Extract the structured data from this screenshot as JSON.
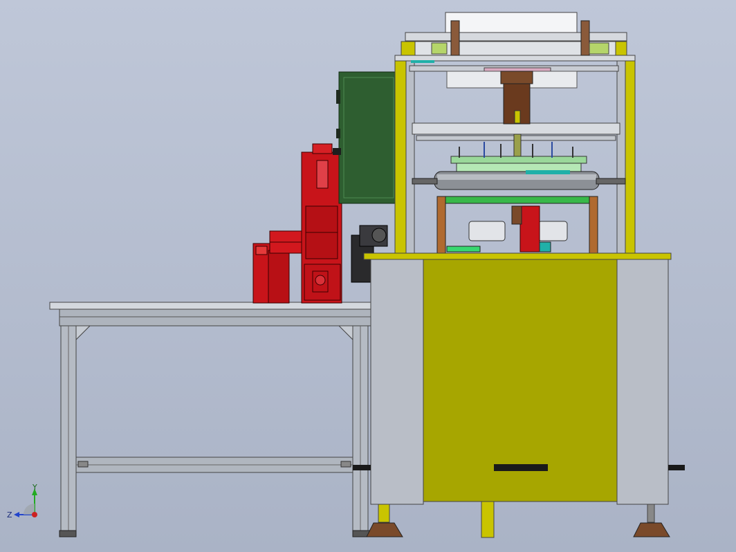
{
  "view": {
    "background_color": "#b3bccd",
    "triad": {
      "x_label": "",
      "y_label": "Y",
      "z_label": "Z",
      "y_axis_color": "#22aa22",
      "z_axis_color": "#2244cc",
      "origin_color": "#cc2222"
    }
  },
  "assembly": {
    "palette": {
      "frame_yellow": "#c9c400",
      "cabinet_yellow": "#a7a600",
      "aluminum": "#b9bec7",
      "motor_red": "#c8141a",
      "panel_green": "#2e5e30",
      "roller_gray": "#8c9096",
      "rubber_brown": "#7a4a2a",
      "plate_green": "#38b84a",
      "teal": "#20b0a8"
    },
    "components": [
      "aluminum-profile-table",
      "red-motor-drive-unit",
      "electrical-control-box",
      "film-roll-holder",
      "upper-frame",
      "pressing-roller",
      "working-platform",
      "base-cabinet",
      "leveling-feet"
    ]
  }
}
